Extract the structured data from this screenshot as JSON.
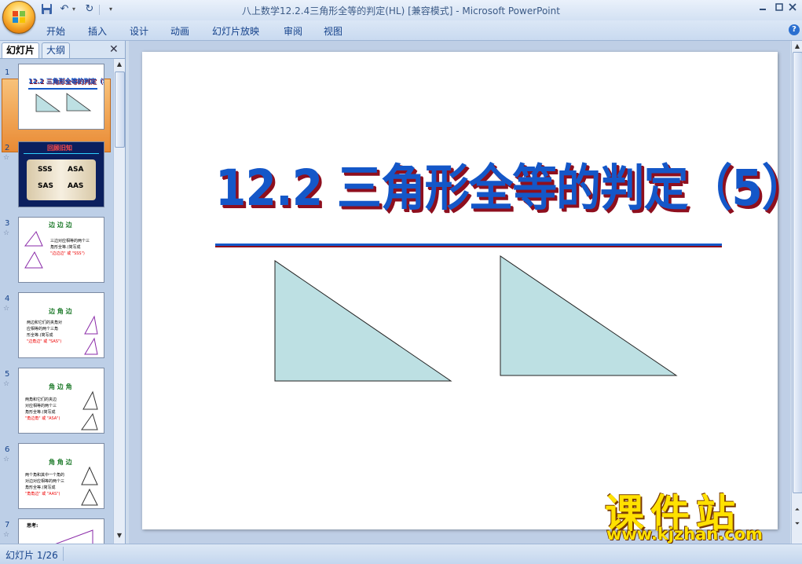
{
  "window": {
    "title": "八上数学12.2.4三角形全等的判定(HL) [兼容模式] - Microsoft PowerPoint",
    "min_icon": "minimize-icon",
    "max_icon": "maximize-icon",
    "close_icon": "close-icon"
  },
  "ribbon": {
    "tabs": [
      "开始",
      "插入",
      "设计",
      "动画",
      "幻灯片放映",
      "审阅",
      "视图"
    ],
    "help": "?"
  },
  "panel": {
    "tab_slides": "幻灯片",
    "tab_outline": "大纲",
    "close": "✕",
    "thumbnails": [
      {
        "num": "1",
        "title": "12.2 三角形全等的判定（5）"
      },
      {
        "num": "2",
        "title": "回顾旧知",
        "labels": [
          "SSS",
          "ASA",
          "SAS",
          "AAS"
        ]
      },
      {
        "num": "3",
        "title": "边 边 边",
        "lines": [
          "三边对应相等的两个三",
          "角形全等.(简写成",
          "\"边边边\" 或 \"SSS\")"
        ]
      },
      {
        "num": "4",
        "title": "边 角 边",
        "lines": [
          "两边和它们的夹角对",
          "应相等的两个三角",
          "形全等.(简写成",
          "\"边角边\" 或 \"SAS\")"
        ]
      },
      {
        "num": "5",
        "title": "角 边 角",
        "lines": [
          "两角和它们的夹边",
          "对应相等的两个三",
          "角形全等.(简写成",
          "\"角边角\" 或 \"ASA\")"
        ]
      },
      {
        "num": "6",
        "title": "角 角 边",
        "lines": [
          "两个角和其中一个角的",
          "对边对应相等的两个三",
          "角形全等.(简写成",
          "\"角角边\" 或 \"AAS\")"
        ]
      },
      {
        "num": "7",
        "title": "思考:"
      }
    ]
  },
  "slide": {
    "title": "12.2  三角形全等的判定（5）",
    "triangle_fill": "#bde0e3",
    "title_color": "#1457c8",
    "shadow_color": "#8e0f1e"
  },
  "watermark": {
    "text": "课件站",
    "url": "www.kjzhan.com"
  },
  "status": {
    "slide_indicator": "幻灯片 1/26"
  }
}
